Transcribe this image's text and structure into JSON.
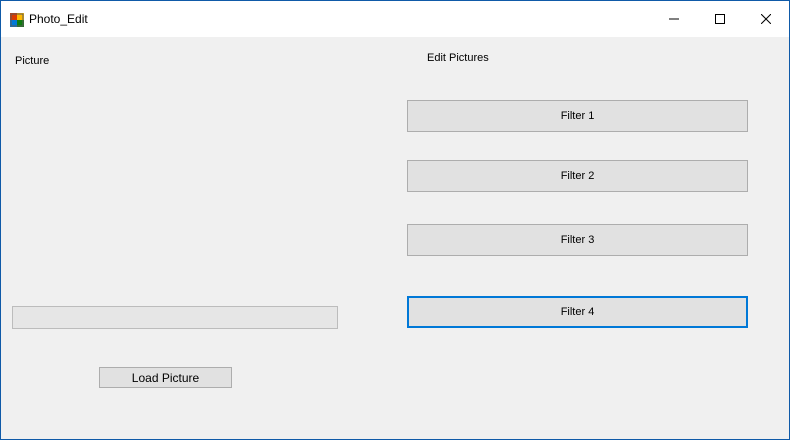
{
  "window": {
    "title": "Photo_Edit",
    "icon": "photo-app-icon",
    "controls": {
      "minimize": "minimize-icon",
      "maximize": "maximize-icon",
      "close": "close-icon"
    }
  },
  "picture_panel": {
    "label": "Picture",
    "progress": {
      "value": 0
    },
    "load_button_label": "Load Picture"
  },
  "edit_panel": {
    "label": "Edit Pictures",
    "filters": [
      {
        "label": "Filter 1",
        "focused": false
      },
      {
        "label": "Filter 2",
        "focused": false
      },
      {
        "label": "Filter 3",
        "focused": false
      },
      {
        "label": "Filter 4",
        "focused": true
      }
    ]
  },
  "colors": {
    "focus_border": "#0078d7",
    "button_face": "#e1e1e1",
    "window_background": "#f0f0f0"
  }
}
